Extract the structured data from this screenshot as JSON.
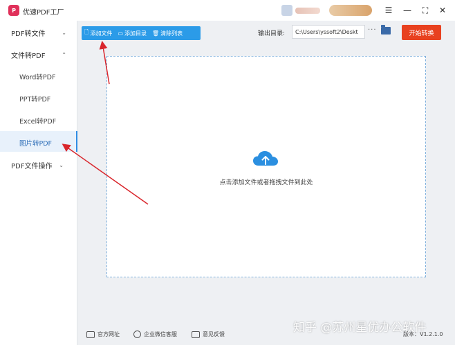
{
  "app": {
    "title": "优速PDF工厂",
    "logo_text": "P"
  },
  "window_controls": {
    "menu": "☰",
    "minimize": "—",
    "maximize": "⛶",
    "close": "✕"
  },
  "sidebar": {
    "groups": [
      {
        "label": "PDF转文件",
        "chevron": "⌄"
      },
      {
        "label": "文件转PDF",
        "chevron": "⌃"
      },
      {
        "label": "PDF文件操作",
        "chevron": "⌄"
      }
    ],
    "sub_items": [
      {
        "label": "Word转PDF"
      },
      {
        "label": "PPT转PDF"
      },
      {
        "label": "Excel转PDF"
      },
      {
        "label": "图片转PDF"
      }
    ]
  },
  "toolbar": {
    "add_file": "添加文件",
    "add_folder": "添加目录",
    "clear_list": "清除列表",
    "output_label": "输出目录:",
    "output_path": "C:\\Users\\yssoft2\\Deskt",
    "more": "···",
    "start": "开始转换"
  },
  "dropzone": {
    "hint": "点击添加文件或者拖拽文件到此处"
  },
  "footer": {
    "website": "官方网址",
    "wechat": "企业微信客服",
    "feedback": "意见反馈",
    "version": "版本：V1.2.1.0"
  },
  "watermark": "知乎 @苏州星优办公软件",
  "colors": {
    "accent": "#2b9be8",
    "start": "#e8411f",
    "arrow": "#d9262c"
  }
}
